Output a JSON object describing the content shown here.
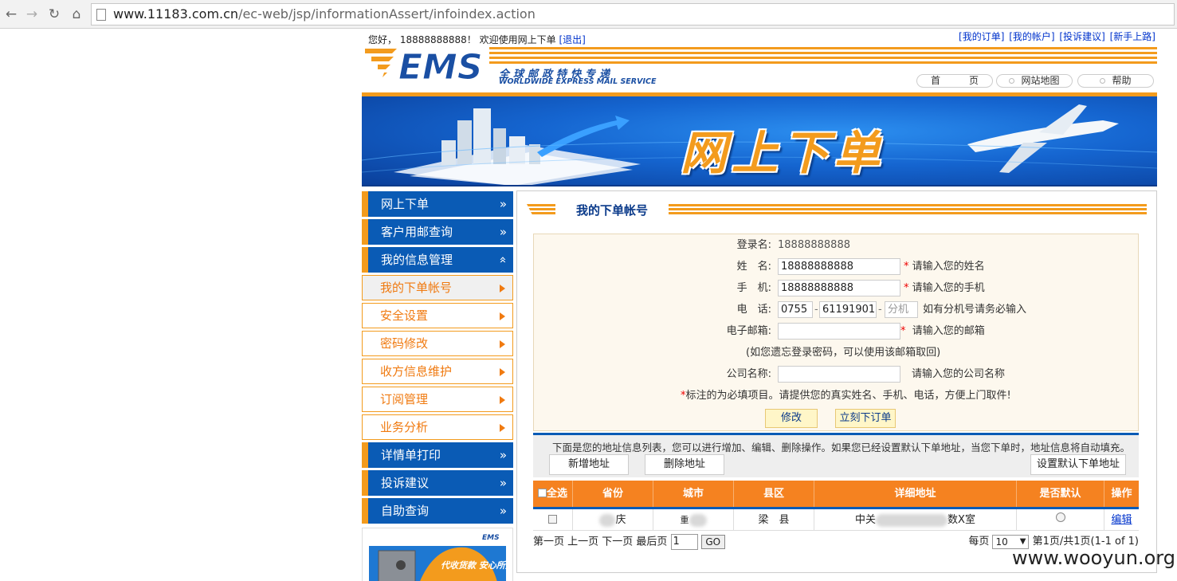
{
  "browser": {
    "url_host": "www.11183.com.cn",
    "url_path": "/ec-web/jsp/informationAssert/infoindex.action"
  },
  "header": {
    "greeting": "您好， 18888888888！  欢迎使用网上下单",
    "logout": "[退出]",
    "links": [
      "[我的订单]",
      "[我的帐户]",
      "[投诉建议]",
      "[新手上路]"
    ],
    "logo_cn": "全球邮政特快专递",
    "logo_en": "WORLDWIDE EXPRESS MAIL SERVICE",
    "logo_text": "EMS",
    "nav": [
      "首　　　页",
      "网站地图",
      "帮助"
    ]
  },
  "banner": {
    "title": "网上下单"
  },
  "sidebar": {
    "items": [
      {
        "label": "网上下单",
        "type": "blue",
        "arrow": "»"
      },
      {
        "label": "客户用邮查询",
        "type": "blue",
        "arrow": "»"
      },
      {
        "label": "我的信息管理",
        "type": "blue",
        "arrow": "«"
      },
      {
        "label": "我的下单帐号",
        "type": "sub-active"
      },
      {
        "label": "安全设置",
        "type": "sub"
      },
      {
        "label": "密码修改",
        "type": "sub"
      },
      {
        "label": "收方信息维护",
        "type": "sub"
      },
      {
        "label": "订阅管理",
        "type": "sub"
      },
      {
        "label": "业务分析",
        "type": "sub"
      },
      {
        "label": "详情单打印",
        "type": "blue",
        "arrow": "»"
      },
      {
        "label": "投诉建议",
        "type": "blue",
        "arrow": "»"
      },
      {
        "label": "自助查询",
        "type": "blue",
        "arrow": "»"
      }
    ],
    "ad_text": "代收货款 安心所托",
    "ad_brand": "EMS"
  },
  "main": {
    "section_title": "我的下单帐号",
    "form": {
      "login_label": "登录名:",
      "login_value": "18888888888",
      "name_label": "姓　名:",
      "name_value": "18888888888",
      "name_hint": "请输入您的姓名",
      "mobile_label": "手　机:",
      "mobile_value": "18888888888",
      "mobile_hint": "请输入您的手机",
      "phone_label": "电　话:",
      "phone_area": "0755",
      "phone_number": "61191901",
      "phone_ext_placeholder": "分机",
      "phone_hint": "如有分机号请务必输入",
      "email_label": "电子邮箱:",
      "email_value": "",
      "email_hint": "请输入您的邮箱",
      "email_note": "(如您遗忘登录密码，可以使用该邮箱取回)",
      "company_label": "公司名称:",
      "company_value": "",
      "company_hint": "请输入您的公司名称",
      "required_note": "标注的为必填项目。请提供您的真实姓名、手机、电话，方便上门取件!",
      "required_star": "*",
      "modify_button": "修改",
      "order_button": "立刻下订单"
    },
    "address": {
      "note": "下面是您的地址信息列表，您可以进行增加、编辑、删除操作。如果您已经设置默认下单地址，当您下单时，地址信息将自动填充。",
      "add_button": "新增地址",
      "delete_button": "删除地址",
      "default_button": "设置默认下单地址",
      "columns": [
        "全选",
        "省份",
        "城市",
        "县区",
        "详细地址",
        "是否默认",
        "操作"
      ],
      "rows": [
        {
          "province": "庆",
          "city": "",
          "district": "梁　县",
          "detail_start": "中关",
          "detail_end": "数X室",
          "edit": "编辑"
        }
      ]
    },
    "pager": {
      "nav": "第一页 上一页 下一页 最后页",
      "page_input": "1",
      "go": "GO",
      "per_page_label": "每页",
      "per_page": "10",
      "summary": "第1页/共1页(1-1 of 1)"
    }
  },
  "watermark": "www.wooyun.org",
  "colors": {
    "orange": "#f39b1d",
    "blue": "#0a5bb5",
    "link": "#0033cc"
  }
}
